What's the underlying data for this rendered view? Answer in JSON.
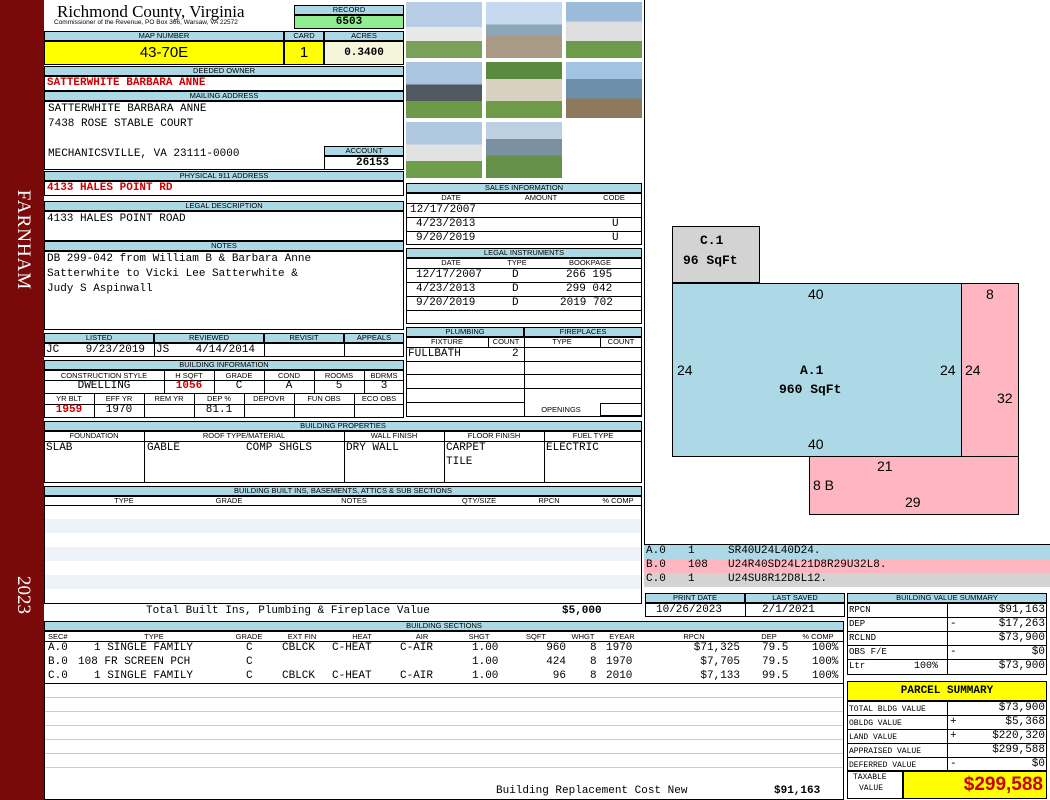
{
  "sidebar": {
    "district": "FARNHAM",
    "year": "2023"
  },
  "header": {
    "county": "Richmond County, Virginia",
    "commissioner": "Commissioner of the Revenue, PO Box 366, Warsaw, VA 22572",
    "record_label": "RECORD",
    "record": "6503",
    "map_label": "MAP NUMBER",
    "map": "43-70E",
    "card_label": "CARD",
    "card": "1",
    "acres_label": "ACRES",
    "acres": "0.3400"
  },
  "owner": {
    "label": "DEEDED OWNER",
    "name": "SATTERWHITE BARBARA ANNE"
  },
  "mailing": {
    "label": "MAILING ADDRESS",
    "line1": "SATTERWHITE BARBARA ANNE",
    "line2": "7438 ROSE STABLE COURT",
    "line3": "MECHANICSVILLE, VA 23111-0000",
    "account_label": "ACCOUNT",
    "account": "26153"
  },
  "physical": {
    "label": "PHYSICAL 911 ADDRESS",
    "value": "4133 HALES POINT RD"
  },
  "legal": {
    "label": "LEGAL DESCRIPTION",
    "value": "4133 HALES POINT ROAD"
  },
  "notes": {
    "label": "NOTES",
    "line1": "DB 299-042 from William B & Barbara Anne",
    "line2": "Satterwhite to Vicki Lee Satterwhite &",
    "line3": "Judy S Aspinwall"
  },
  "listed": {
    "listed_label": "LISTED",
    "reviewed_label": "REVIEWED",
    "revisit_label": "REVISIT",
    "appeals_label": "APPEALS",
    "listed": "JC    9/23/2019",
    "reviewed": "JS    4/14/2014"
  },
  "building_info": {
    "label": "BUILDING INFORMATION",
    "h_style": "CONSTRUCTION STYLE",
    "h_hsqft": "H SQFT",
    "h_grade": "GRADE",
    "h_cond": "COND",
    "h_rooms": "ROOMS",
    "h_bdrms": "BDRMS",
    "style": "DWELLING",
    "hsqft": "1056",
    "grade": "C",
    "cond": "A",
    "rooms": "5",
    "bdrms": "3",
    "h_yrblt": "YR BLT",
    "h_effyr": "EFF YR",
    "h_remyr": "REM YR",
    "h_dep": "DEP %",
    "h_depovr": "DEPOVR",
    "h_funobs": "FUN OBS",
    "h_ecoobs": "ECO OBS",
    "yrblt": "1959",
    "effyr": "1970",
    "dep": "81.1"
  },
  "sales": {
    "label": "SALES INFORMATION",
    "h_date": "DATE",
    "h_amount": "AMOUNT",
    "h_code": "CODE",
    "rows": [
      {
        "date": "12/17/2007",
        "amount": "",
        "code": ""
      },
      {
        "date": "4/23/2013",
        "amount": "",
        "code": "U"
      },
      {
        "date": "9/20/2019",
        "amount": "",
        "code": "U"
      }
    ]
  },
  "instruments": {
    "label": "LEGAL INSTRUMENTS",
    "h_date": "DATE",
    "h_type": "TYPE",
    "h_book": "BOOKPAGE",
    "rows": [
      {
        "date": "12/17/2007",
        "type": "D",
        "book": "266 195"
      },
      {
        "date": "4/23/2013",
        "type": "D",
        "book": "299 042"
      },
      {
        "date": "9/20/2019",
        "type": "D",
        "book": "2019 702"
      }
    ]
  },
  "plumbing": {
    "label": "PLUMBING",
    "h_fixture": "FIXTURE",
    "h_count": "COUNT",
    "fixture": "FULLBATH",
    "count": "2"
  },
  "fireplaces": {
    "label": "FIREPLACES",
    "h_type": "TYPE",
    "h_count": "COUNT",
    "openings": "OPENINGS"
  },
  "properties": {
    "label": "BUILDING PROPERTIES",
    "h_foundation": "FOUNDATION",
    "h_roof": "ROOF TYPE/MATERIAL",
    "h_wall": "WALL FINISH",
    "h_floor": "FLOOR FINISH",
    "h_fuel": "FUEL TYPE",
    "foundation": "SLAB",
    "roof_type": "GABLE",
    "roof_mat": "COMP SHGLS",
    "wall": "DRY WALL",
    "floor1": "CARPET",
    "floor2": "TILE",
    "fuel": "ELECTRIC"
  },
  "builtins": {
    "label": "BUILDING BUILT INS, BASEMENTS, ATTICS & SUB SECTIONS",
    "h_type": "TYPE",
    "h_grade": "GRADE",
    "h_notes": "NOTES",
    "h_qty": "QTY/SIZE",
    "h_rpcn": "RPCN",
    "h_comp": "% COMP",
    "total_label": "Total Built Ins, Plumbing & Fireplace Value",
    "total": "$5,000"
  },
  "print": {
    "h_print": "PRINT DATE",
    "h_saved": "LAST SAVED",
    "print_date": "10/26/2023",
    "last_saved": "2/1/2021"
  },
  "sections": {
    "label": "BUILDING SECTIONS",
    "headers": [
      "SEC#",
      "TYPE",
      "GRADE",
      "EXT FIN",
      "HEAT",
      "AIR",
      "SHGT",
      "SQFT",
      "WHGT",
      "EYEAR",
      "RPCN",
      "DEP",
      "% COMP"
    ],
    "rows": [
      {
        "sec": "A.0",
        "type": "1 SINGLE FAMILY",
        "grade": "C",
        "ext": "CBLCK",
        "heat": "C-HEAT",
        "air": "C-AIR",
        "shgt": "1.00",
        "sqft": "960",
        "whgt": "8",
        "eyear": "1970",
        "rpcn": "$71,325",
        "dep": "79.5",
        "comp": "100%"
      },
      {
        "sec": "B.0",
        "type": "108 FR SCREEN PCH",
        "grade": "C",
        "ext": "",
        "heat": "",
        "air": "",
        "shgt": "1.00",
        "sqft": "424",
        "whgt": "8",
        "eyear": "1970",
        "rpcn": "$7,705",
        "dep": "79.5",
        "comp": "100%"
      },
      {
        "sec": "C.0",
        "type": "1 SINGLE FAMILY",
        "grade": "C",
        "ext": "CBLCK",
        "heat": "C-HEAT",
        "air": "C-AIR",
        "shgt": "1.00",
        "sqft": "96",
        "whgt": "8",
        "eyear": "2010",
        "rpcn": "$7,133",
        "dep": "99.5",
        "comp": "100%"
      }
    ],
    "footer_label": "Building Replacement Cost New",
    "footer_value": "$91,163"
  },
  "sketch": {
    "c_label": "C.1",
    "c_area": "96 SqFt",
    "a_label": "A.1",
    "a_area": "960 SqFt",
    "b_label": "8 B",
    "dims": [
      "40",
      "40",
      "24",
      "24",
      "8",
      "24",
      "32",
      "21",
      "29"
    ],
    "colors": {
      "a": "#add8e6",
      "b": "#ffb6c1",
      "c": "#d3d3d3"
    },
    "legend": [
      {
        "code": "A.0",
        "num": "1",
        "path": "SR40U24L40D24."
      },
      {
        "code": "B.0",
        "num": "108",
        "path": "U24R40SD24L21D8R29U32L8."
      },
      {
        "code": "C.0",
        "num": "1",
        "path": "U24SU8R12D8L12."
      }
    ]
  },
  "value_summary": {
    "label": "BUILDING VALUE SUMMARY",
    "rows": [
      {
        "label": "RPCN",
        "sign": "",
        "value": "$91,163"
      },
      {
        "label": "DEP",
        "sign": "-",
        "value": "$17,263"
      },
      {
        "label": "RCLND",
        "sign": "",
        "value": "$73,900"
      },
      {
        "label": "OBS F/E",
        "sign": "-",
        "value": "$0"
      },
      {
        "label": "Ltr",
        "pct": "100%",
        "sign": "",
        "value": "$73,900"
      }
    ]
  },
  "parcel": {
    "label": "PARCEL SUMMARY",
    "rows": [
      {
        "label": "TOTAL BLDG VALUE",
        "sign": "",
        "value": "$73,900"
      },
      {
        "label": "OBLDG VALUE",
        "sign": "+",
        "value": "$5,368"
      },
      {
        "label": "LAND VALUE",
        "sign": "+",
        "value": "$220,320"
      },
      {
        "label": "APPRAISED VALUE",
        "sign": "",
        "value": "$299,588"
      },
      {
        "label": "DEFERRED VALUE",
        "sign": "-",
        "value": "$0"
      }
    ],
    "taxable_label1": "TAXABLE",
    "taxable_label2": "VALUE",
    "taxable": "$299,588"
  }
}
